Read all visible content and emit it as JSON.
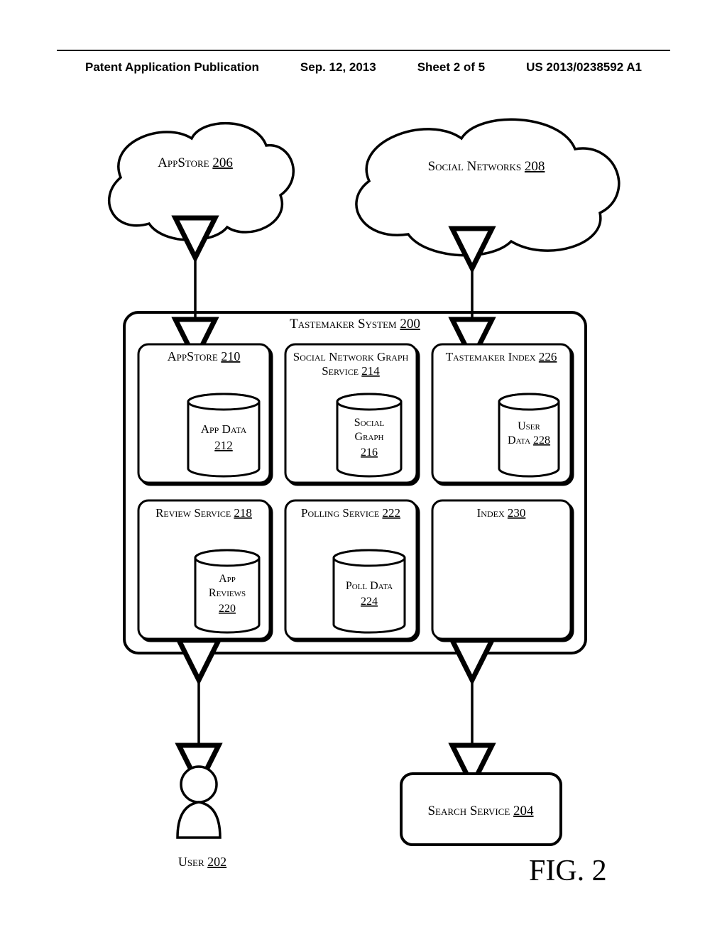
{
  "header": {
    "pub_type": "Patent Application Publication",
    "date": "Sep. 12, 2013",
    "sheet": "Sheet 2 of 5",
    "app_number": "US 2013/0238592 A1"
  },
  "figure_label": "FIG. 2",
  "clouds": {
    "appstore": {
      "label": "AppStore",
      "num": "206"
    },
    "social": {
      "label": "Social Networks",
      "num": "208"
    }
  },
  "system": {
    "label": "Tastemaker System",
    "num": "200"
  },
  "boxes": {
    "appstore_svc": {
      "label": "AppStore",
      "num": "210",
      "db_label": "App Data",
      "db_num": "212"
    },
    "sng": {
      "label1": "Social Network Graph",
      "label2": "Service",
      "num": "214",
      "db_label1": "Social",
      "db_label2": "Graph",
      "db_num": "216"
    },
    "tm_index": {
      "label": "Tastemaker Index",
      "num": "226",
      "db_label1": "User",
      "db_label2": "Data",
      "db_num": "228"
    },
    "review": {
      "label": "Review Service",
      "num": "218",
      "db_label1": "App",
      "db_label2": "Reviews",
      "db_num": "220"
    },
    "polling": {
      "label": "Polling Service",
      "num": "222",
      "db_label": "Poll Data",
      "db_num": "224"
    },
    "index": {
      "label": "Index",
      "num": "230"
    }
  },
  "user": {
    "label": "User",
    "num": "202"
  },
  "search": {
    "label": "Search Service",
    "num": "204"
  }
}
